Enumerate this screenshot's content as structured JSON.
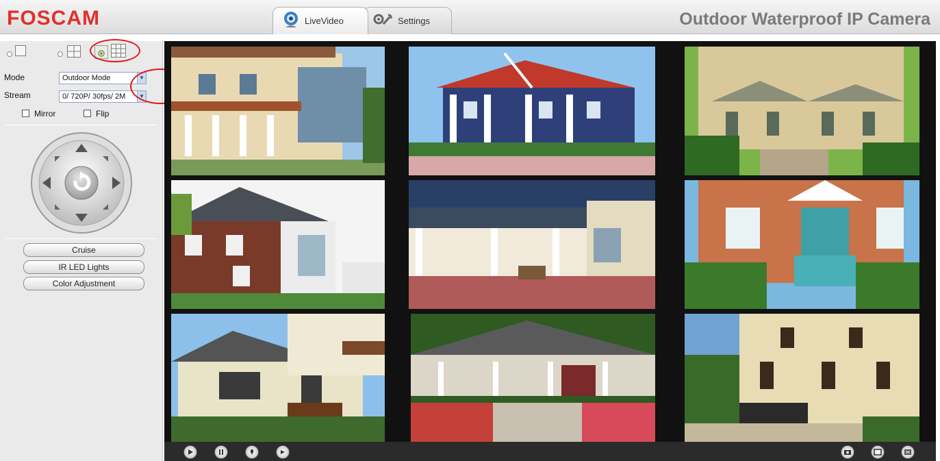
{
  "header": {
    "logo": "FOSCAM",
    "title": "Outdoor Waterproof IP Camera",
    "tabs": [
      {
        "label": "LiveVideo",
        "icon": "webcam-icon",
        "active": true
      },
      {
        "label": "Settings",
        "icon": "wrench-gear-icon",
        "active": false
      }
    ]
  },
  "left_panel": {
    "layout_options": [
      "single-view",
      "four-view",
      "nine-view"
    ],
    "mode": {
      "label": "Mode",
      "value": "Outdoor Mode"
    },
    "stream": {
      "label": "Stream",
      "value": "0/ 720P/ 30fps/ 2M"
    },
    "mirror_label": "Mirror",
    "flip_label": "Flip",
    "buttons": {
      "cruise": "Cruise",
      "ir_led": "IR LED Lights",
      "color_adjust": "Color Adjustment"
    }
  },
  "video_grid": {
    "rows": 3,
    "cols": 3,
    "cells": [
      "house-1",
      "house-2",
      "house-3",
      "house-4",
      "house-5",
      "house-6",
      "house-7",
      "house-8",
      "house-9"
    ]
  },
  "bottom_bar": {
    "left_icons": [
      "play-icon",
      "stop-icon",
      "talk-icon",
      "record-icon"
    ],
    "right_icons": [
      "snapshot-icon",
      "fullscreen-icon",
      "close-icon"
    ]
  },
  "colors": {
    "brand": "#e0312a",
    "highlight": "#e01818",
    "panel": "#eaeaea"
  }
}
